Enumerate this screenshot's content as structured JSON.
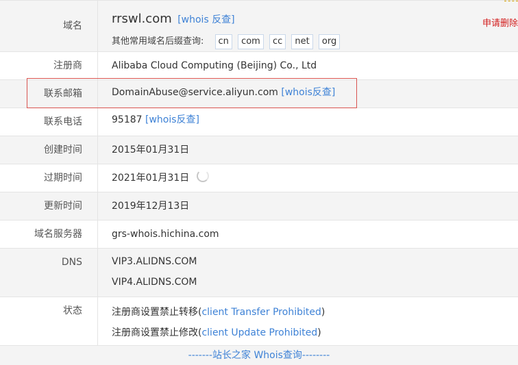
{
  "rows": {
    "domain": {
      "label": "域名",
      "name": "rrswl.com",
      "whois_link": "[whois 反查]",
      "suffix_prompt": "其他常用域名后缀查询:",
      "suffixes": [
        "cn",
        "com",
        "cc",
        "net",
        "org"
      ],
      "delete_link": "申请删除"
    },
    "registrar": {
      "label": "注册商",
      "value": "Alibaba Cloud Computing (Beijing) Co., Ltd"
    },
    "email": {
      "label": "联系邮箱",
      "value": "DomainAbuse@service.aliyun.com",
      "link": "[whois反查]"
    },
    "phone": {
      "label": "联系电话",
      "value": "95187",
      "link": "[whois反查]"
    },
    "created": {
      "label": "创建时间",
      "value": "2015年01月31日"
    },
    "expires": {
      "label": "过期时间",
      "value": "2021年01月31日"
    },
    "updated": {
      "label": "更新时间",
      "value": "2019年12月13日"
    },
    "nameserver": {
      "label": "域名服务器",
      "value": "grs-whois.hichina.com"
    },
    "dns": {
      "label": "DNS",
      "values": [
        "VIP3.ALIDNS.COM",
        "VIP4.ALIDNS.COM"
      ]
    },
    "status": {
      "label": "状态",
      "items": [
        {
          "prefix": "注册商设置禁止转移(",
          "code": "client Transfer Prohibited",
          "suffix": ")"
        },
        {
          "prefix": "注册商设置禁止修改(",
          "code": "client Update Prohibited",
          "suffix": ")"
        }
      ]
    }
  },
  "footer": "-------站长之家 Whois查询--------",
  "colors": {
    "link": "#3e82d6",
    "delete": "#d21c1c",
    "highlight": "#d9534f",
    "row_gray": "#f4f4f4"
  }
}
